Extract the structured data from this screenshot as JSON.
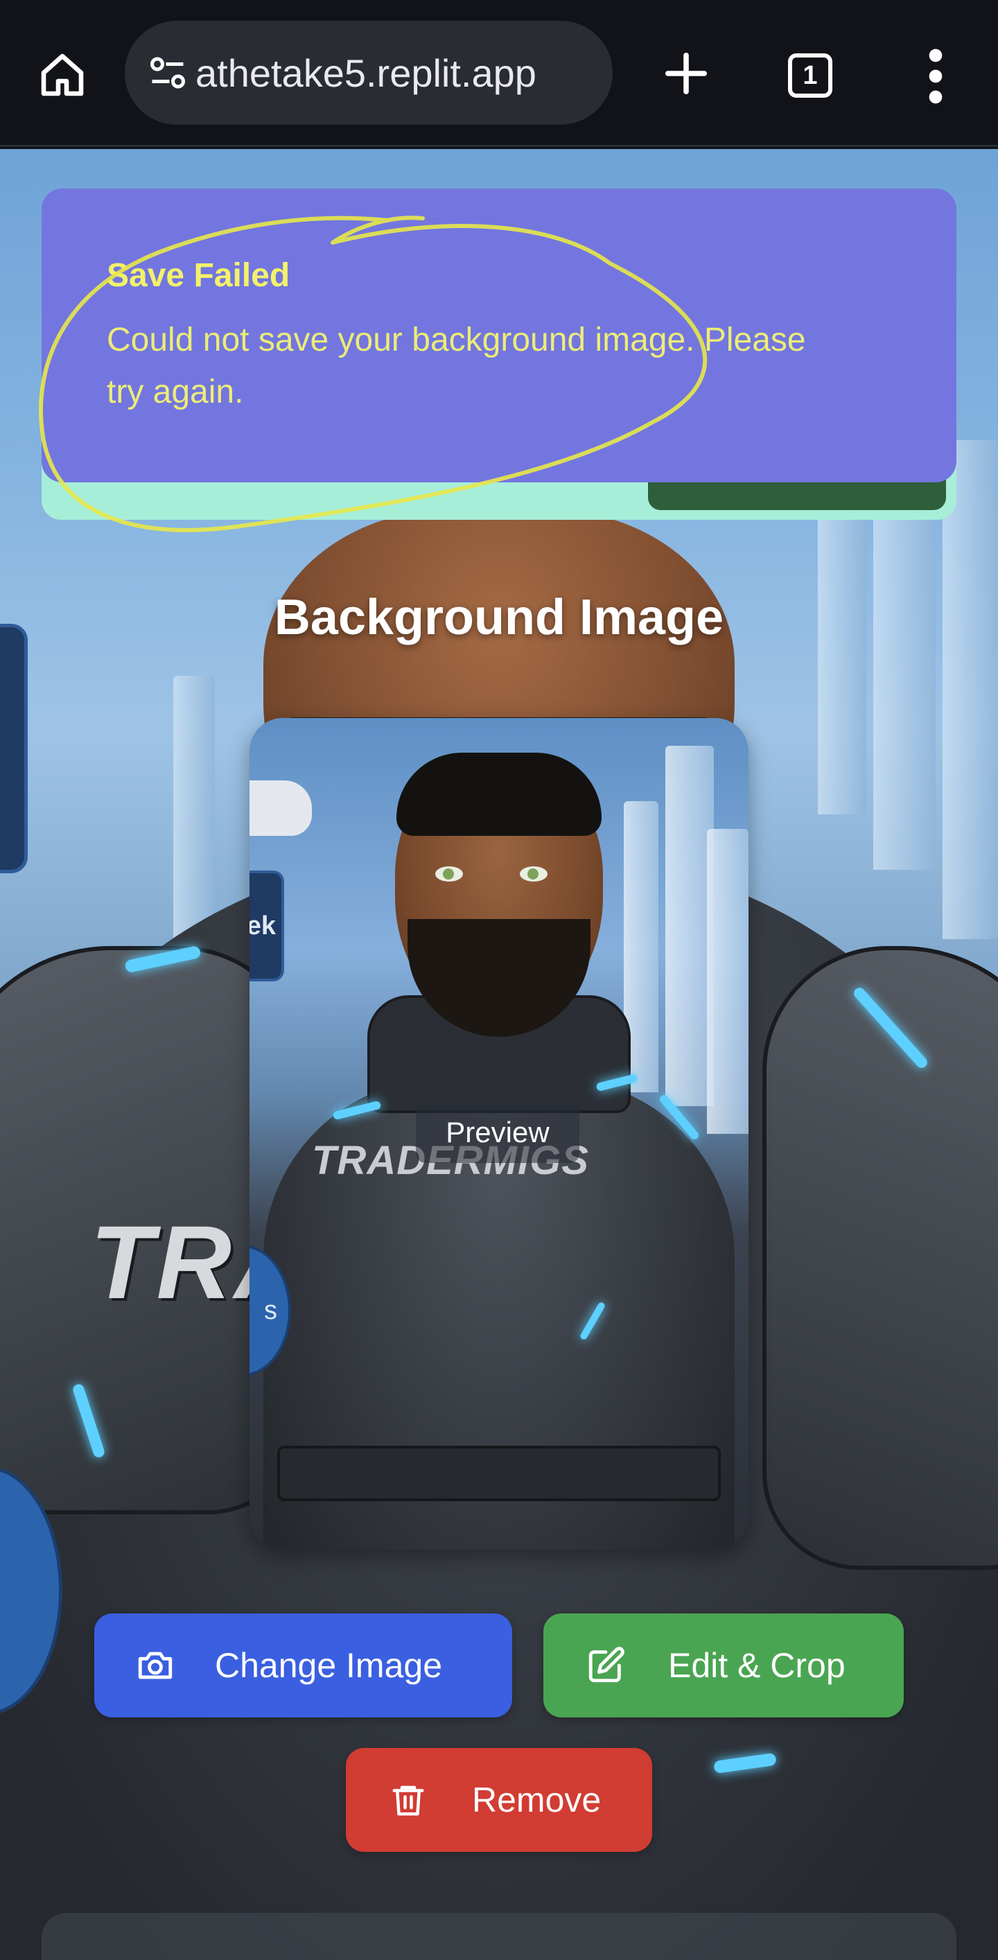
{
  "browser": {
    "url": "athetake5.replit.app",
    "tab_count": "1",
    "icons": [
      "home-icon",
      "site-settings-icon",
      "new-tab-icon",
      "tab-switcher-icon",
      "more-menu-icon"
    ]
  },
  "toast": {
    "title": "Save Failed",
    "message": "Could not save your background image. Please try again.",
    "colors": {
      "background": "#7376de",
      "text": "#f3f26a",
      "annotation": "#e8e84a"
    }
  },
  "section": {
    "title": "Background Image"
  },
  "preview": {
    "badge": "Preview",
    "brand_text": "TRADERMIGS"
  },
  "background_art": {
    "brand_text": "TRA"
  },
  "actions": {
    "change_image": {
      "label": "Change Image",
      "icon": "camera-icon",
      "color": "#3a5fe0"
    },
    "edit_crop": {
      "label": "Edit & Crop",
      "icon": "edit-icon",
      "color": "#4aa552"
    },
    "remove": {
      "label": "Remove",
      "icon": "trash-icon",
      "color": "#d13c33"
    }
  }
}
